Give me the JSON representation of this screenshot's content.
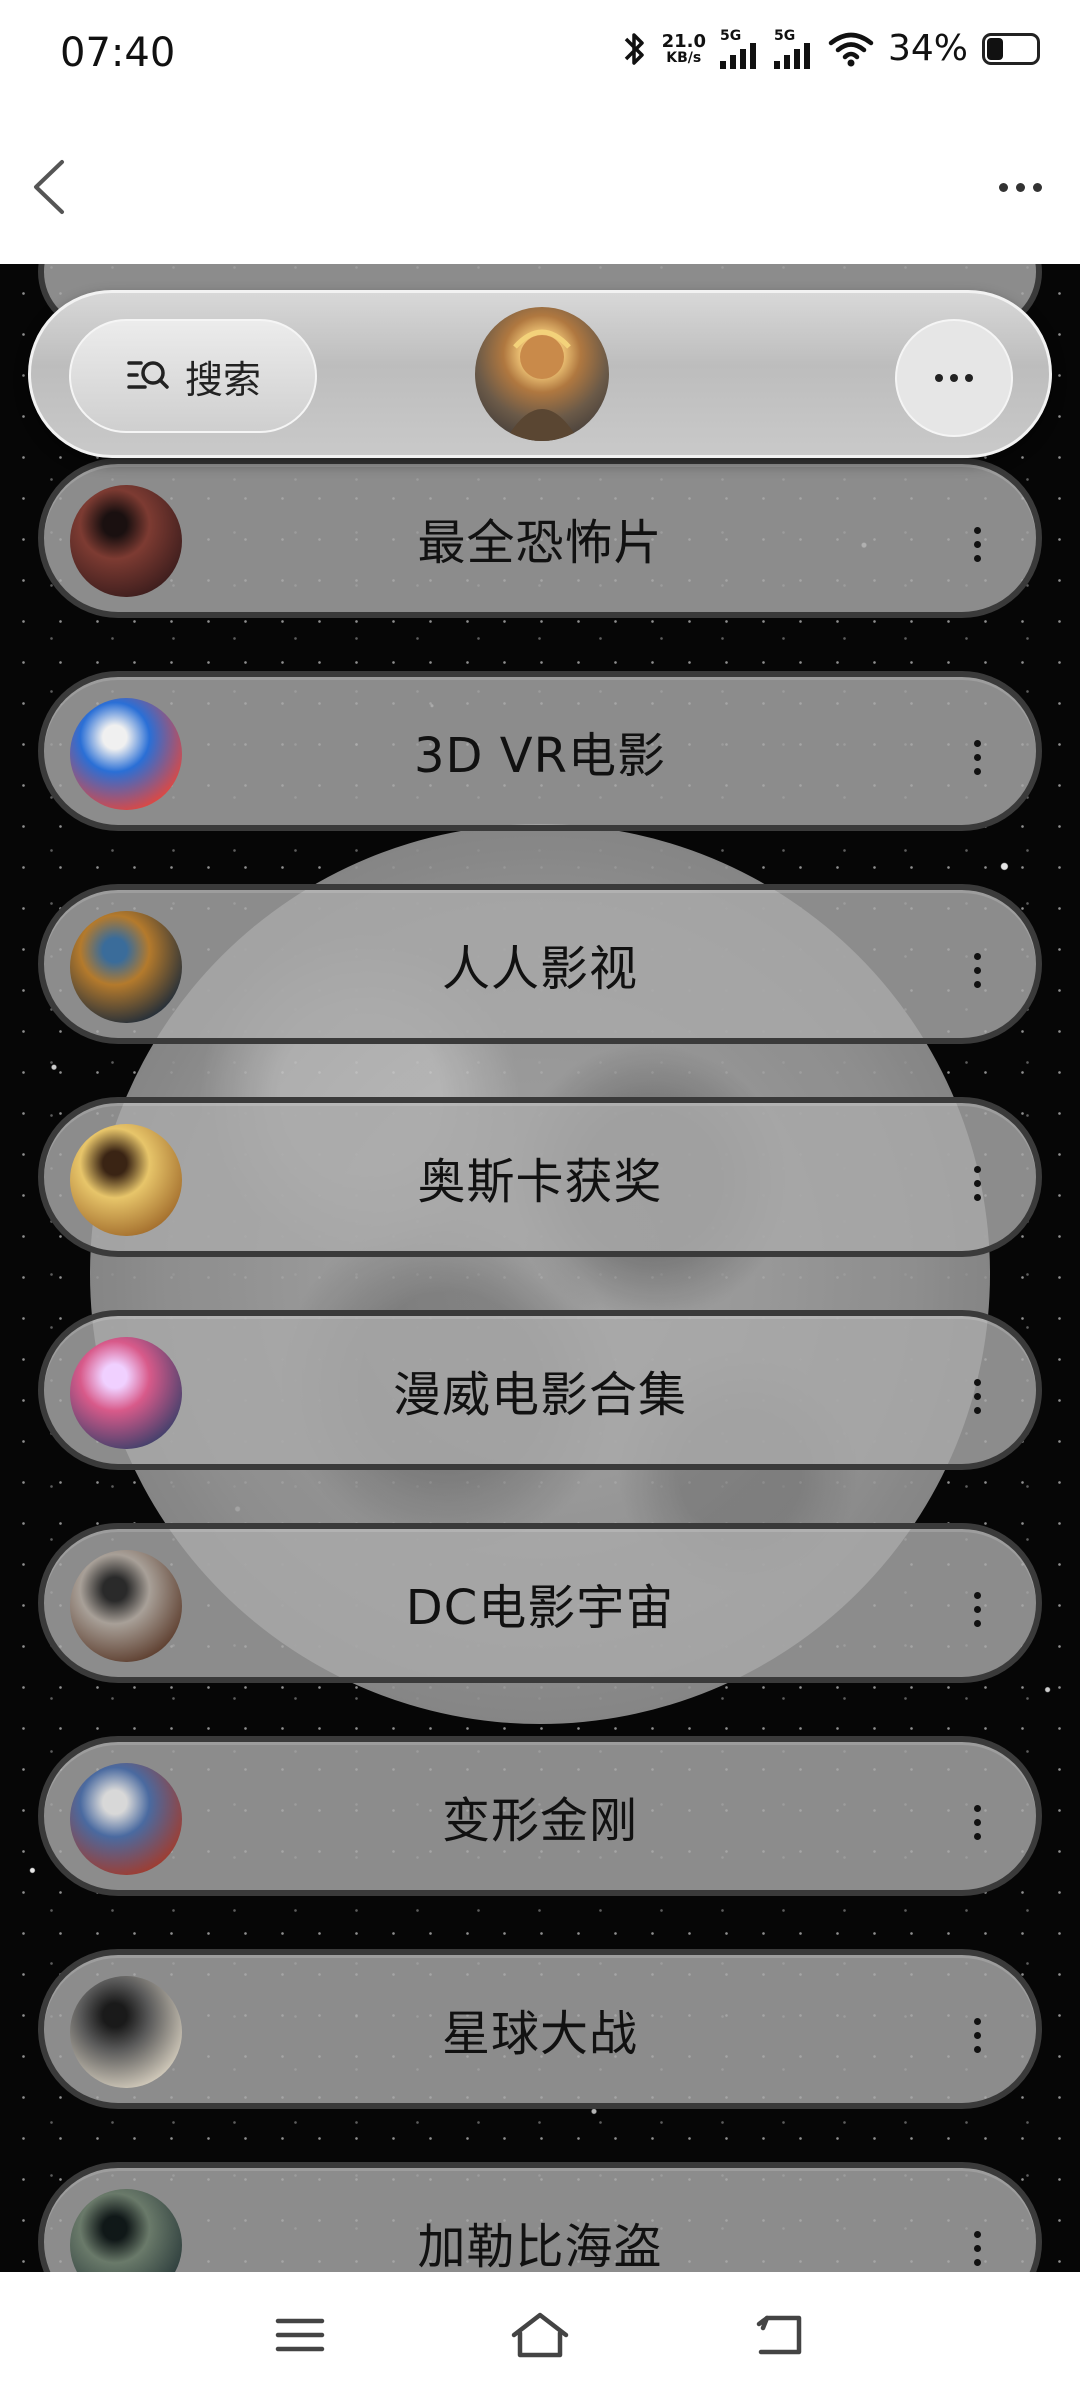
{
  "status_bar": {
    "time": "07:40",
    "net_speed_value": "21.0",
    "net_speed_unit": "KB/s",
    "signal1_label": "5G",
    "signal2_label": "5G",
    "battery": "34%"
  },
  "floating_bar": {
    "search_label": "搜索"
  },
  "list": {
    "items": [
      {
        "title": "最全恐怖片",
        "thumb_colors": [
          "#3a1c1c",
          "#7d3b32",
          "#1a1010"
        ]
      },
      {
        "title": "3D VR电影",
        "thumb_colors": [
          "#e8463a",
          "#2a6fd6",
          "#f0f0f0"
        ]
      },
      {
        "title": "人人影视",
        "thumb_colors": [
          "#1c2a3a",
          "#b47a2c",
          "#3a6c9a"
        ]
      },
      {
        "title": "奥斯卡获奖",
        "thumb_colors": [
          "#a06a2a",
          "#e7c56a",
          "#3a2414"
        ]
      },
      {
        "title": "漫威电影合集",
        "thumb_colors": [
          "#3a3f6a",
          "#d85a8a",
          "#f0d0ff"
        ]
      },
      {
        "title": "DC电影宇宙",
        "thumb_colors": [
          "#5a3a2a",
          "#a8a098",
          "#2a2a2a"
        ]
      },
      {
        "title": "变形金刚",
        "thumb_colors": [
          "#a43a2a",
          "#4a6aa0",
          "#d8d8d8"
        ]
      },
      {
        "title": "星球大战",
        "thumb_colors": [
          "#d8d0c0",
          "#5a5a5a",
          "#1a1a1a"
        ]
      },
      {
        "title": "加勒比海盗",
        "thumb_colors": [
          "#2a3a3a",
          "#6a7a6a",
          "#101818"
        ]
      }
    ]
  }
}
